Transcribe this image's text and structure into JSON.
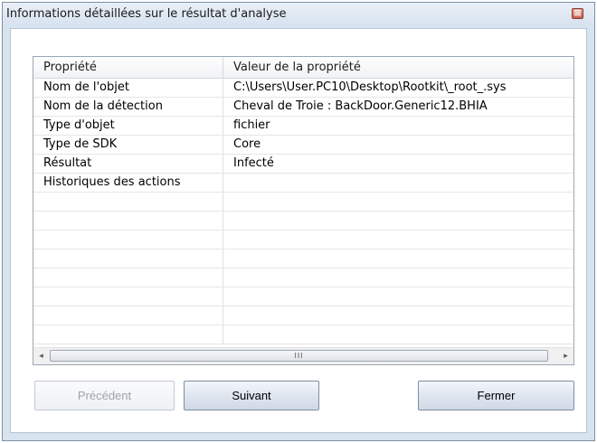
{
  "window": {
    "title": "Informations détaillées sur le résultat d'analyse",
    "close_glyph": "⊠"
  },
  "table": {
    "columns": [
      "Propriété",
      "Valeur de la propriété"
    ],
    "rows": [
      {
        "property": "Nom de l'objet",
        "value": "C:\\Users\\User.PC10\\Desktop\\Rootkit\\_root_.sys"
      },
      {
        "property": "Nom de la détection",
        "value": "Cheval de Troie : BackDoor.Generic12.BHIA"
      },
      {
        "property": "Type d'objet",
        "value": "fichier"
      },
      {
        "property": "Type de SDK",
        "value": "Core"
      },
      {
        "property": "Résultat",
        "value": "Infecté"
      },
      {
        "property": "Historiques des actions",
        "value": ""
      }
    ],
    "scrollbar": {
      "left_arrow": "◂",
      "right_arrow": "▸",
      "grip": "III"
    }
  },
  "buttons": {
    "previous": "Précédent",
    "next": "Suivant",
    "close": "Fermer"
  }
}
